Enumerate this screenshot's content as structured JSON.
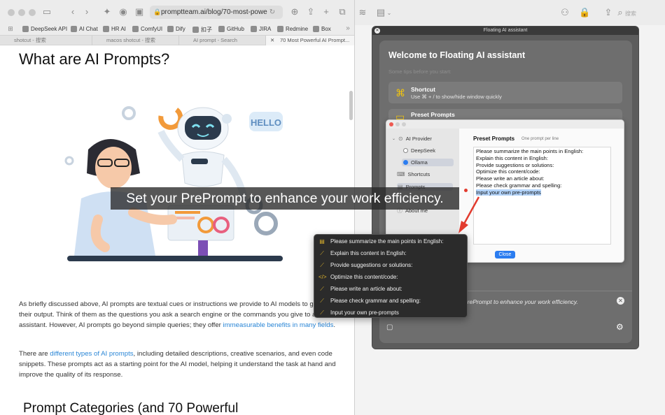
{
  "browser": {
    "address": "promptteam.ai/blog/70-most-powe",
    "bookmarks": [
      {
        "label": "DeepSeek API"
      },
      {
        "label": "AI Chat"
      },
      {
        "label": "HR AI"
      },
      {
        "label": "ComfyUI"
      },
      {
        "label": "Dify"
      },
      {
        "label": "扣子"
      },
      {
        "label": "GitHub"
      },
      {
        "label": "JIRA"
      },
      {
        "label": "Redmine"
      },
      {
        "label": "Box"
      }
    ],
    "tabs": [
      {
        "label": "shotcut - 搜索"
      },
      {
        "label": "macos shotcut - 搜索"
      },
      {
        "label": "AI prompt - Search"
      },
      {
        "label": "70 Most Powerful AI Prompt..."
      }
    ],
    "right_search_placeholder": "搜索"
  },
  "article": {
    "heading": "What are AI Prompts?",
    "illustration_text": "HELLO",
    "para1_a": "As briefly discussed above, AI prompts are textual cues or instructions we provide to AI models to guide their output. Think of them as the questions you ask a search engine or the commands you give to a virtual assistant. However, AI prompts go beyond simple queries; they offer ",
    "para1_link": "immeasurable benefits in many fields",
    "para1_b": ".",
    "para2_a": "There are ",
    "para2_link": "different types of AI prompts",
    "para2_b": ", including detailed descriptions, creative scenarios, and even code snippets. These prompts act as a starting point for the AI model, helping it understand the task at hand and improve the quality of its response.",
    "heading2": "Prompt Categories (and 70 Powerful"
  },
  "floating": {
    "window_title": "Floating AI assistant",
    "welcome": "Welcome to Floating AI assistant",
    "tips": "Some tips before you start:",
    "shortcut_title": "Shortcut",
    "shortcut_sub": "Use ⌘ + / to show/hide window quickly",
    "preset_title": "Preset Prompts",
    "input_text": "PrePrompt to enhance your work efficiency."
  },
  "settings": {
    "sidebar": {
      "ai_provider": "AI Provider",
      "deepseek": "DeepSeek",
      "ollama": "Ollama",
      "shortcuts": "Shortcuts",
      "prompts": "Prompts",
      "about": "About me"
    },
    "title": "Preset Prompts",
    "subtitle": "One prompt per line",
    "lines": [
      "Please summarize the main points in English:",
      "Explain this content in English:",
      "Provide suggestions or solutions:",
      "Optimize this content/code:",
      "Please write an article about:",
      "Please check grammar and spelling:"
    ],
    "highlighted_line": "Input your own pre-prompts",
    "close_label": "Close"
  },
  "menu": {
    "items": [
      {
        "label": "Please summarize the main points in English:",
        "icon": "summary-icon"
      },
      {
        "label": "Explain this content in English:",
        "icon": "sparkle-icon"
      },
      {
        "label": "Provide suggestions or solutions:",
        "icon": "sparkle-icon"
      },
      {
        "label": "Optimize this content/code:",
        "icon": "code-icon"
      },
      {
        "label": "Please write an article about:",
        "icon": "sparkle-icon"
      },
      {
        "label": "Please check grammar and spelling:",
        "icon": "sparkle-icon"
      },
      {
        "label": "Input your own pre-prompts",
        "icon": "sparkle-icon"
      }
    ]
  },
  "caption": "Set your PrePrompt to enhance your work efficiency."
}
